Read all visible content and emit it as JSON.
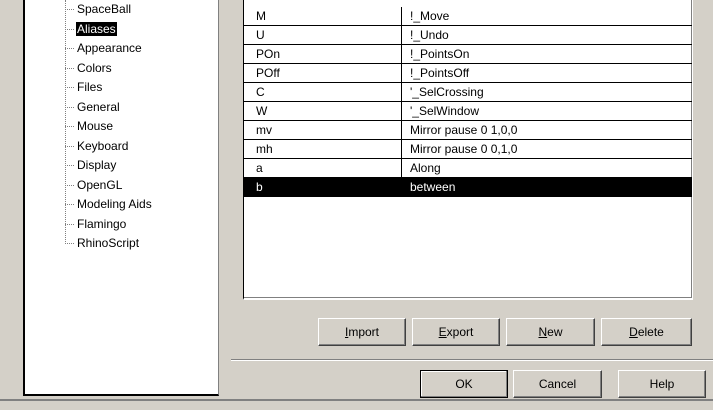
{
  "tree": {
    "items": [
      {
        "label": "SpaceBall",
        "selected": false
      },
      {
        "label": "Aliases",
        "selected": true
      },
      {
        "label": "Appearance",
        "selected": false
      },
      {
        "label": "Colors",
        "selected": false
      },
      {
        "label": "Files",
        "selected": false
      },
      {
        "label": "General",
        "selected": false
      },
      {
        "label": "Mouse",
        "selected": false
      },
      {
        "label": "Keyboard",
        "selected": false
      },
      {
        "label": "Display",
        "selected": false
      },
      {
        "label": "OpenGL",
        "selected": false
      },
      {
        "label": "Modeling Aids",
        "selected": false
      },
      {
        "label": "Flamingo",
        "selected": false
      },
      {
        "label": "RhinoScript",
        "selected": false
      }
    ]
  },
  "aliases": {
    "rows": [
      {
        "alias": "M",
        "command": "!_Move",
        "selected": false
      },
      {
        "alias": "U",
        "command": "!_Undo",
        "selected": false
      },
      {
        "alias": "POn",
        "command": "!_PointsOn",
        "selected": false
      },
      {
        "alias": "POff",
        "command": "!_PointsOff",
        "selected": false
      },
      {
        "alias": "C",
        "command": "'_SelCrossing",
        "selected": false
      },
      {
        "alias": "W",
        "command": "'_SelWindow",
        "selected": false
      },
      {
        "alias": "mv",
        "command": "Mirror pause 0 1,0,0",
        "selected": false
      },
      {
        "alias": "mh",
        "command": "Mirror pause 0 0,1,0",
        "selected": false
      },
      {
        "alias": "a",
        "command": "Along",
        "selected": false
      },
      {
        "alias": "b",
        "command": "between",
        "selected": true
      }
    ]
  },
  "buttons": {
    "import_rest": "mport",
    "import_key": "I",
    "export_key": "E",
    "export_rest": "xport",
    "new_key": "N",
    "new_rest": "ew",
    "delete_key": "D",
    "delete_rest": "elete",
    "ok": "OK",
    "cancel": "Cancel",
    "help": "Help"
  },
  "colors": {
    "dialog_bg": "#d4d0c8",
    "selection_bg": "#000000",
    "selection_fg": "#ffffff"
  }
}
